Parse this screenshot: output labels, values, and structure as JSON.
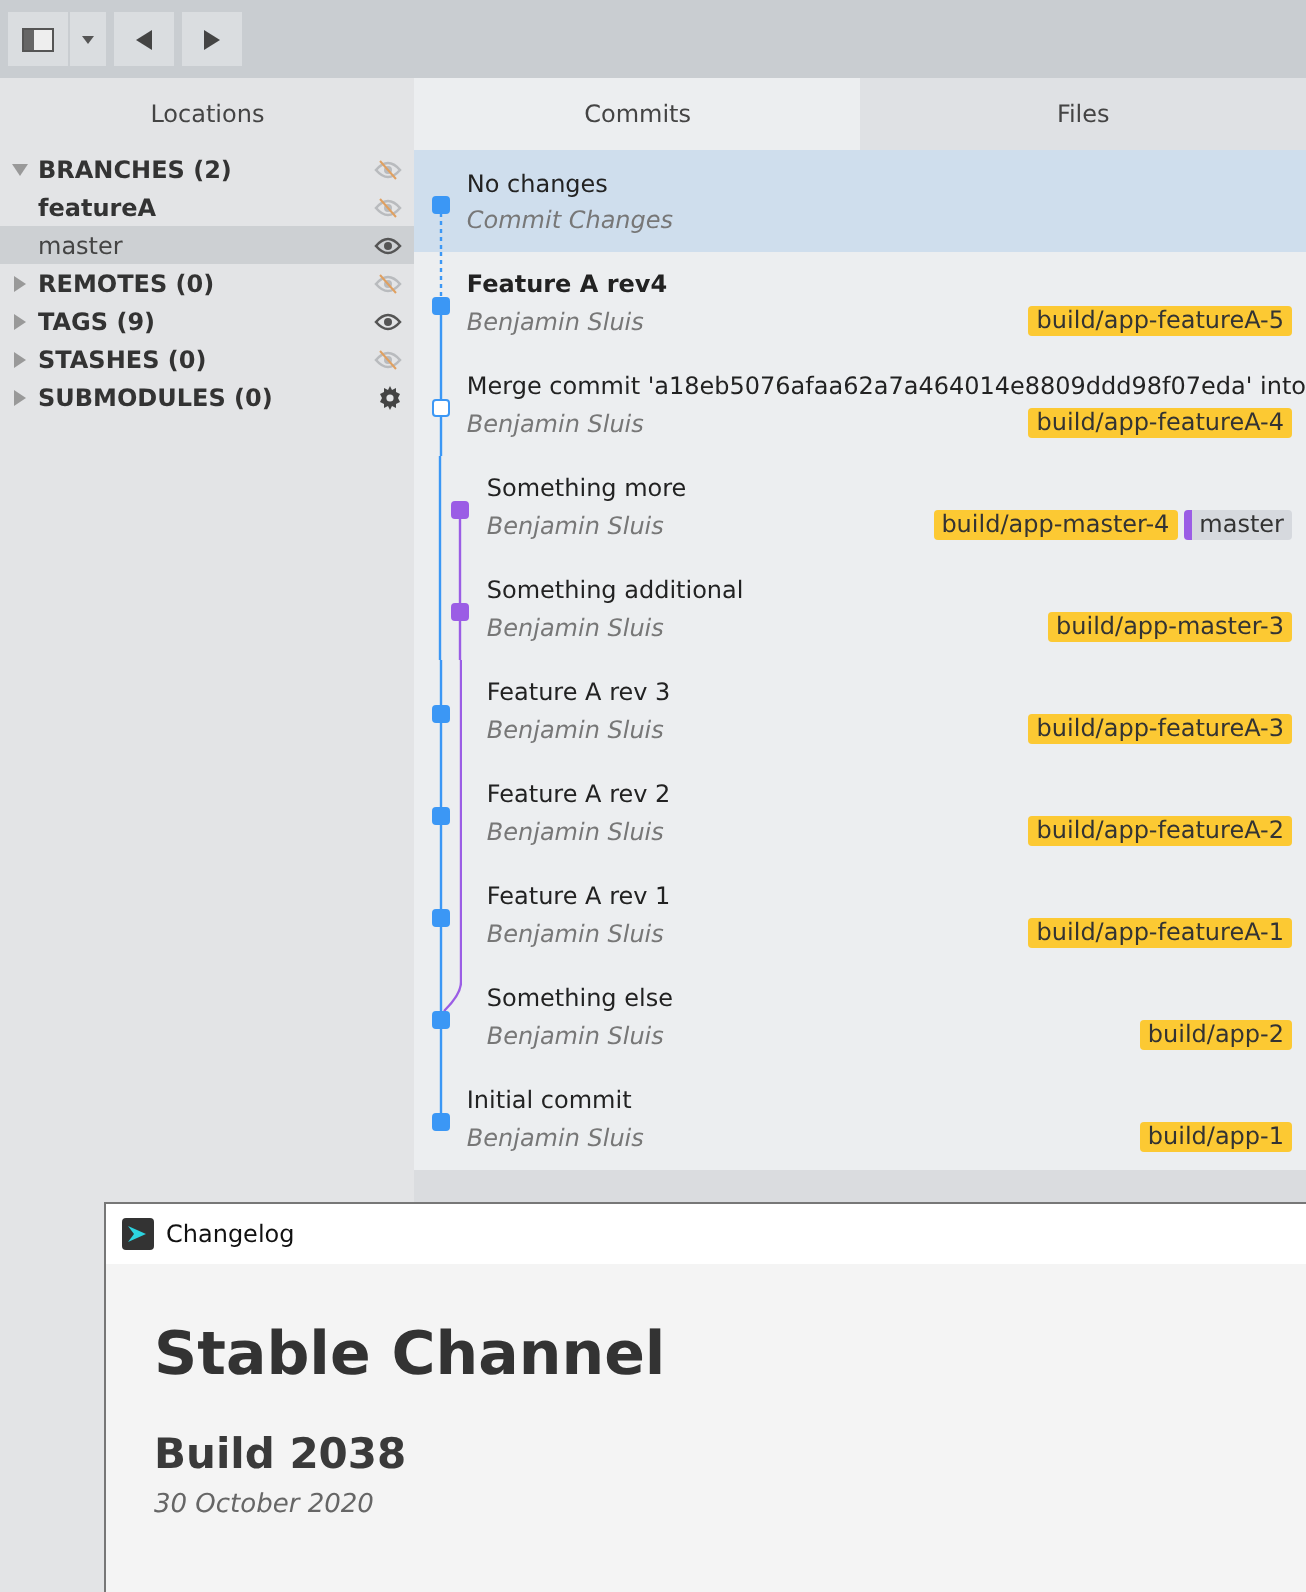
{
  "toolbar": {
    "buttons": [
      {
        "kind": "sidebar"
      },
      {
        "kind": "dropdown"
      },
      {
        "kind": "back"
      },
      {
        "kind": "forward"
      }
    ]
  },
  "sidebar": {
    "title": "Locations",
    "items": [
      {
        "kind": "section",
        "label": "BRANCHES (2)",
        "expanded": true,
        "visible": false
      },
      {
        "kind": "branch",
        "label": "featureA",
        "current": true,
        "selected": false,
        "visible": false
      },
      {
        "kind": "branch",
        "label": "master",
        "current": false,
        "selected": true,
        "visible": true
      },
      {
        "kind": "section",
        "label": "REMOTES (0)",
        "expanded": false,
        "visible": false
      },
      {
        "kind": "section",
        "label": "TAGS (9)",
        "expanded": false,
        "visible": true
      },
      {
        "kind": "section",
        "label": "STASHES (0)",
        "expanded": false,
        "visible": false
      },
      {
        "kind": "settings",
        "label": "SUBMODULES (0)",
        "expanded": false
      }
    ]
  },
  "tabs": [
    {
      "label": "Commits",
      "selected": true
    },
    {
      "label": "Files",
      "selected": false
    }
  ],
  "commits": [
    {
      "kind": "working",
      "title": "No changes",
      "author": "Commit Changes",
      "current": false,
      "selected": true
    },
    {
      "kind": "head",
      "title": "Feature A rev4",
      "author": "Benjamin Sluis",
      "current": true,
      "selected": false,
      "refs": [
        {
          "kind": "tag",
          "label": "build/app-featureA-5"
        }
      ]
    },
    {
      "kind": "merge",
      "title": "Merge commit 'a18eb5076afaa62a7a464014e8809ddd98f07eda' into",
      "author": "Benjamin Sluis",
      "current": false,
      "selected": false,
      "refs": [
        {
          "kind": "tag",
          "label": "build/app-featureA-4"
        }
      ]
    },
    {
      "kind": "sidetop",
      "title": "Something more",
      "author": "Benjamin Sluis",
      "current": false,
      "selected": false,
      "refs": [
        {
          "kind": "tag",
          "label": "build/app-master-4"
        },
        {
          "kind": "branch",
          "label": "master"
        }
      ]
    },
    {
      "kind": "side",
      "title": "Something additional",
      "author": "Benjamin Sluis",
      "current": false,
      "selected": false,
      "refs": [
        {
          "kind": "tag",
          "label": "build/app-master-3"
        }
      ]
    },
    {
      "kind": "beside",
      "title": "Feature A rev 3",
      "author": "Benjamin Sluis",
      "current": false,
      "selected": false,
      "refs": [
        {
          "kind": "tag",
          "label": "build/app-featureA-3"
        }
      ]
    },
    {
      "kind": "beside",
      "title": "Feature A rev 2",
      "author": "Benjamin Sluis",
      "current": false,
      "selected": false,
      "refs": [
        {
          "kind": "tag",
          "label": "build/app-featureA-2"
        }
      ]
    },
    {
      "kind": "beside",
      "title": "Feature A rev 1",
      "author": "Benjamin Sluis",
      "current": false,
      "selected": false,
      "refs": [
        {
          "kind": "tag",
          "label": "build/app-featureA-1"
        }
      ]
    },
    {
      "kind": "fork",
      "title": "Something else",
      "author": "Benjamin Sluis",
      "current": false,
      "selected": false,
      "refs": [
        {
          "kind": "tag",
          "label": "build/app-2"
        }
      ]
    },
    {
      "kind": "root",
      "title": "Initial commit",
      "author": "Benjamin Sluis",
      "current": false,
      "selected": false,
      "refs": [
        {
          "kind": "tag",
          "label": "build/app-1"
        }
      ]
    }
  ],
  "changelog": {
    "title": "Changelog",
    "heading": "Stable Channel",
    "build": "Build 2038",
    "date": "30 October 2020"
  }
}
